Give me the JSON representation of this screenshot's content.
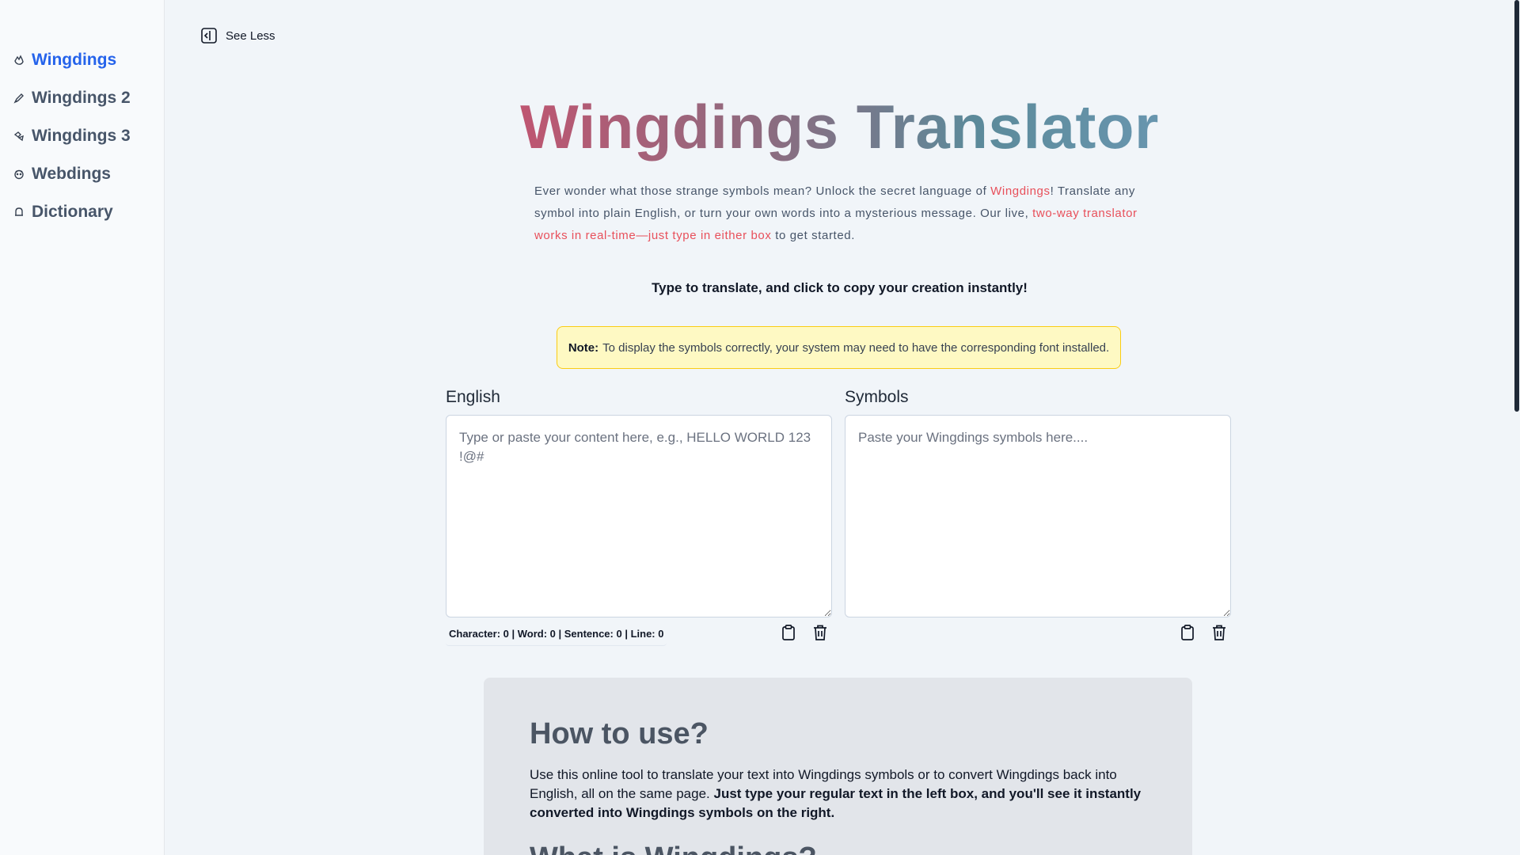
{
  "sidebar": {
    "items": [
      {
        "label": "Wingdings",
        "icon": "wingdings-hand-icon",
        "active": true
      },
      {
        "label": "Wingdings 2",
        "icon": "wingdings2-pen-icon",
        "active": false
      },
      {
        "label": "Wingdings 3",
        "icon": "wingdings3-shapes-icon",
        "active": false
      },
      {
        "label": "Webdings",
        "icon": "webdings-face-icon",
        "active": false
      },
      {
        "label": "Dictionary",
        "icon": "bell-icon",
        "active": false
      }
    ]
  },
  "header": {
    "see_less_label": "See Less",
    "title": "Wingdings Translator"
  },
  "intro": {
    "part1": "Ever wonder what those strange symbols mean? Unlock the secret language of ",
    "highlight1": "Wingdings",
    "part2": "! Translate any symbol into plain English, or turn your own words into a mysterious message. Our live, ",
    "highlight2": "two-way translator works in real-time—just type in either box",
    "part3": " to get started."
  },
  "tagline": "Type to translate, and click to copy your creation instantly!",
  "note": {
    "label": "Note:",
    "text": "To display the symbols correctly, your system may need to have the corresponding font installed."
  },
  "english_panel": {
    "label": "English",
    "placeholder": "Type or paste your content here, e.g., HELLO WORLD 123 !@#",
    "value": "",
    "stats": "Character: 0 | Word: 0 | Sentence: 0 | Line: 0"
  },
  "symbols_panel": {
    "label": "Symbols",
    "placeholder": "Paste your Wingdings symbols here....",
    "value": ""
  },
  "howto": {
    "heading": "How to use?",
    "text": "Use this online tool to translate your text into Wingdings symbols or to convert Wingdings back into English, all on the same page. ",
    "bold": "Just type your regular text in the left box, and you'll see it instantly converted into Wingdings symbols on the right.",
    "next_heading": "What is Wingdings?"
  },
  "colors": {
    "accent": "#2563eb",
    "highlight": "#e8505b",
    "note_bg": "#fef9c3",
    "note_border": "#facc15"
  }
}
